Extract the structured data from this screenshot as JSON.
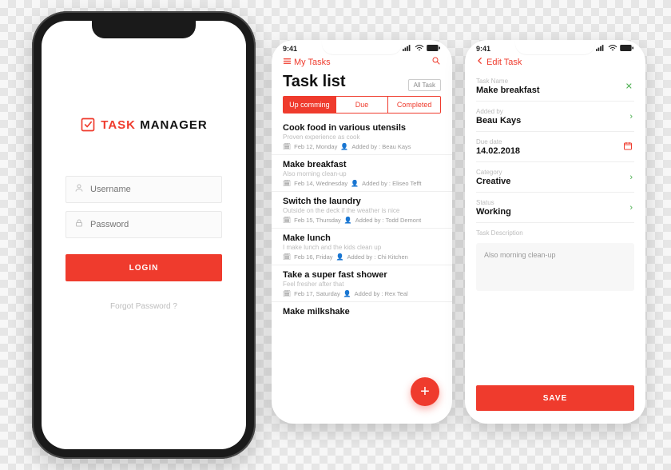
{
  "accent": "#ef3b2d",
  "login": {
    "logo_accent": "TASK",
    "logo_rest": " MANAGER",
    "username_placeholder": "Username",
    "password_placeholder": "Password",
    "login_button": "LOGIN",
    "forgot": "Forgot Password ?"
  },
  "statusbar": {
    "time": "9:41"
  },
  "tasks": {
    "back_label": "My Tasks",
    "title": "Task list",
    "all_task": "All Task",
    "tabs": {
      "upcoming": "Up comming",
      "due": "Due",
      "completed": "Completed"
    },
    "items": [
      {
        "title": "Cook food in various utensils",
        "sub": "Proven experience as cook",
        "date": "Feb 12, Monday",
        "added_by": "Beau Kays"
      },
      {
        "title": "Make breakfast",
        "sub": "Also morning clean-up",
        "date": "Feb 14, Wednesday",
        "added_by": "Eliseo Tefft"
      },
      {
        "title": "Switch the laundry",
        "sub": "Outside on the deck if the weather is nice",
        "date": "Feb 15, Thursday",
        "added_by": "Todd Demont"
      },
      {
        "title": "Make lunch",
        "sub": "I make lunch and the kids clean up",
        "date": "Feb 16, Friday",
        "added_by": "Chi Kitchen"
      },
      {
        "title": "Take a super fast shower",
        "sub": "Feel fresher after that",
        "date": "Feb 17, Saturday",
        "added_by": "Rex Teal"
      },
      {
        "title": "Make milkshake",
        "sub": "",
        "date": "",
        "added_by": ""
      }
    ],
    "added_by_prefix": "Added by : "
  },
  "edit": {
    "back_label": "Edit Task",
    "fields": {
      "task_name": {
        "label": "Task Name",
        "value": "Make breakfast"
      },
      "added_by": {
        "label": "Added by",
        "value": "Beau Kays"
      },
      "due_date": {
        "label": "Due date",
        "value": "14.02.2018"
      },
      "category": {
        "label": "Category",
        "value": "Creative"
      },
      "status": {
        "label": "Status",
        "value": "Working"
      }
    },
    "description_label": "Task Description",
    "description_value": "Also morning clean-up",
    "save_button": "SAVE"
  }
}
